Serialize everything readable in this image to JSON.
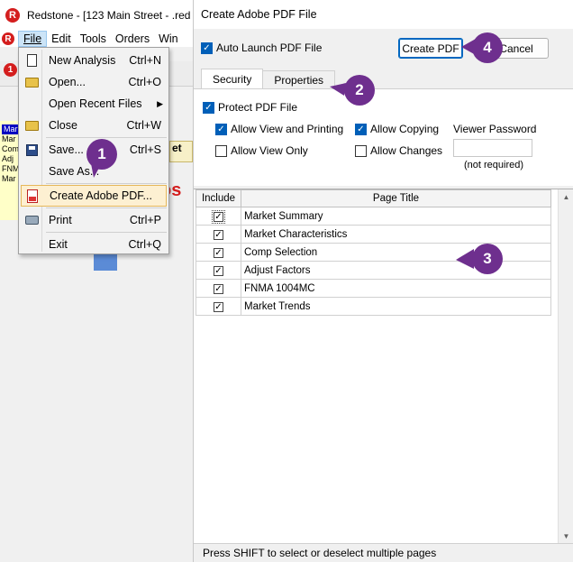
{
  "app": {
    "title": "Redstone - [123 Main Street - .red",
    "logo_letter": "R",
    "menu": [
      "File",
      "Edit",
      "Tools",
      "Orders",
      "Win"
    ],
    "side_list": [
      "Mar",
      "Mar",
      "Com",
      "Adj",
      "FNM",
      "Mar"
    ],
    "tab_partial": "et",
    "logo_partial": "os",
    "badge": "1"
  },
  "file_menu": {
    "items": [
      {
        "label": "New Analysis",
        "shortcut": "Ctrl+N",
        "icon": "new-document-icon"
      },
      {
        "label": "Open...",
        "shortcut": "Ctrl+O",
        "icon": "open-folder-icon"
      },
      {
        "label": "Open Recent Files",
        "shortcut": "",
        "icon": "",
        "submenu": true
      },
      {
        "label": "Close",
        "shortcut": "Ctrl+W",
        "icon": "close-folder-icon"
      },
      {
        "label": "Save...",
        "shortcut": "Ctrl+S",
        "icon": "save-disk-icon"
      },
      {
        "label": "Save As...",
        "shortcut": "",
        "icon": ""
      },
      {
        "label": "Create Adobe PDF...",
        "shortcut": "",
        "icon": "pdf-icon"
      },
      {
        "label": "Print",
        "shortcut": "Ctrl+P",
        "icon": "printer-icon"
      },
      {
        "label": "Exit",
        "shortcut": "Ctrl+Q",
        "icon": ""
      }
    ],
    "submenu_arrow": "▶"
  },
  "dialog": {
    "title": "Create Adobe PDF File",
    "auto_launch_label": "Auto Launch PDF File",
    "create_button": "Create PDF",
    "cancel_button": "Cancel",
    "tabs": [
      "Security",
      "Properties"
    ],
    "protect_label": "Protect PDF File",
    "options": {
      "allow_view_printing": "Allow View and Printing",
      "allow_copying": "Allow Copying",
      "allow_view_only": "Allow View Only",
      "allow_changes": "Allow Changes"
    },
    "viewer_password_label": "Viewer Password",
    "viewer_password_note": "(not required)",
    "viewer_password_value": "",
    "grid": {
      "headers": [
        "Include",
        "Page Title"
      ],
      "rows": [
        {
          "title": "Market Summary",
          "checked": true
        },
        {
          "title": "Market Characteristics",
          "checked": true
        },
        {
          "title": "Comp Selection",
          "checked": true
        },
        {
          "title": "Adjust Factors",
          "checked": true
        },
        {
          "title": "FNMA 1004MC",
          "checked": true
        },
        {
          "title": "Market Trends",
          "checked": true
        }
      ]
    },
    "status": "Press SHIFT to select or deselect multiple pages"
  },
  "callouts": [
    "1",
    "2",
    "3",
    "4"
  ],
  "colors": {
    "accent": "#005fb8",
    "callout": "#6e2f8e",
    "brand_red": "#d41e1e",
    "menu_highlight": "#fdf0d2"
  }
}
